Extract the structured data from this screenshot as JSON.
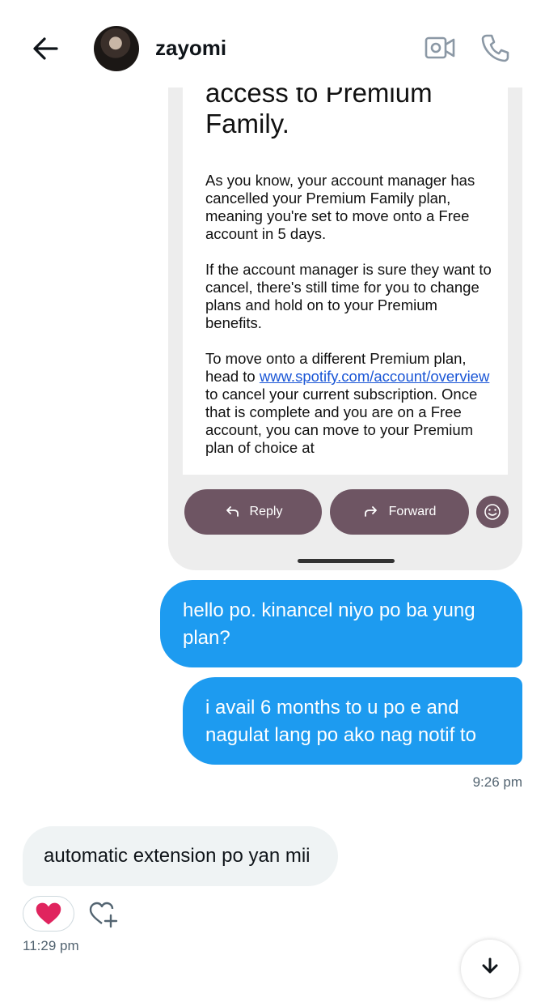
{
  "header": {
    "contact_name": "zayomi",
    "back_icon": "arrow-left-icon",
    "video_icon": "video-camera-icon",
    "phone_icon": "phone-icon"
  },
  "screenshot": {
    "heading": "access to Premium Family.",
    "paragraph1": "As you know, your account manager has cancelled your Premium Family plan, meaning you're set to move onto a Free account in 5 days.",
    "paragraph2": "If the account manager is sure they want to cancel, there's still time for you to change plans and hold on to your Premium benefits.",
    "paragraph3_before": "To move onto a different Premium plan, head to ",
    "paragraph3_link": "www.spotify.com/account/overview",
    "paragraph3_after": " to cancel your current subscription. Once that is complete and you are on a Free account, you can move to your Premium plan of choice at",
    "reply_label": "Reply",
    "forward_label": "Forward",
    "button_color": "#6e5563"
  },
  "messages": {
    "outgoing1": "hello po. kinancel niyo po ba yung plan?",
    "outgoing2": "i avail 6 months to u po e and nagulat lang po ako nag notif to",
    "outgoing_time": "9:26 pm",
    "incoming1": "automatic extension po yan mii",
    "incoming_time": "11:29 pm",
    "reaction": "❤️",
    "outgoing_color": "#1d9bf0",
    "incoming_color": "#eff3f4"
  }
}
